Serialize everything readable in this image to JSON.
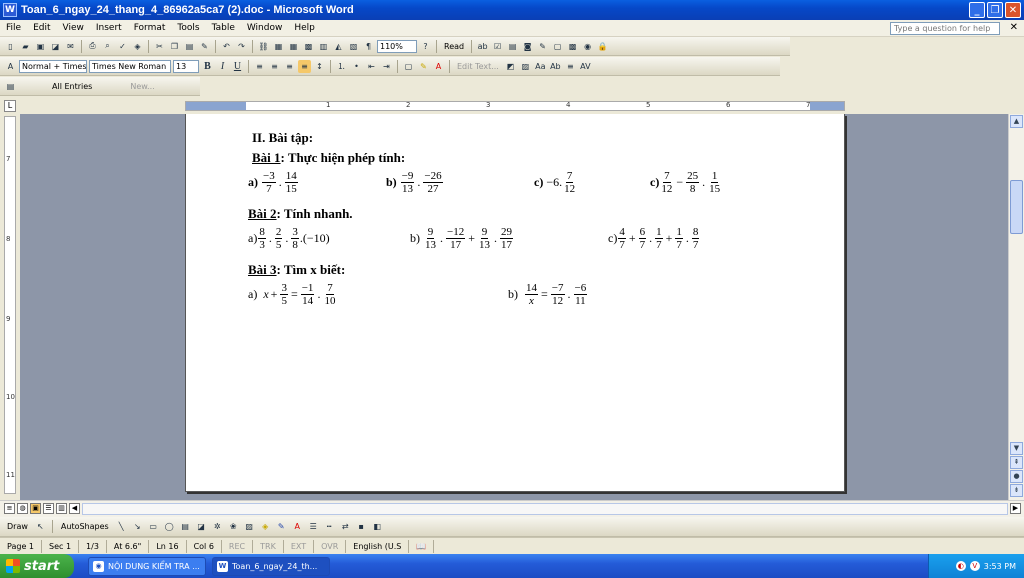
{
  "window": {
    "title": "Toan_6_ngay_24_thang_4_86962a5ca7 (2).doc - Microsoft Word",
    "app_icon": "W"
  },
  "menu": {
    "items": [
      "File",
      "Edit",
      "View",
      "Insert",
      "Format",
      "Tools",
      "Table",
      "Window",
      "Help"
    ],
    "help_placeholder": "Type a question for help"
  },
  "toolbar_standard": {
    "zoom": "110%",
    "read_label": "Read"
  },
  "toolbar_formatting": {
    "style": "Normal + Times",
    "font": "Times New Roman",
    "size": "13",
    "bold": "B",
    "italic": "I",
    "underline": "U",
    "edit_text_label": "Edit Text..."
  },
  "autotext": {
    "entries_label": "All Entries",
    "new_label": "New..."
  },
  "ruler": {
    "numbers": [
      "1",
      "2",
      "3",
      "4",
      "5",
      "6",
      "7"
    ],
    "vertical_numbers": [
      "7",
      "8",
      "9",
      "10",
      "11"
    ]
  },
  "document": {
    "section_heading": "II. Bài tập:",
    "bai1": {
      "title": "Bài 1",
      "text": ": Thực hiện phép tính:"
    },
    "bai2": {
      "title": "Bài 2",
      "text": ": Tính nhanh."
    },
    "bai3": {
      "title": "Bài 3",
      "text": ": Tìm x biết:"
    },
    "b1": {
      "a": {
        "label": "a)",
        "f1n": "−3",
        "f1d": "7",
        "f2n": "14",
        "f2d": "15"
      },
      "b": {
        "label": "b)",
        "f1n": "−9",
        "f1d": "13",
        "f2n": "−26",
        "f2d": "27"
      },
      "c": {
        "label": "c)",
        "pre": "−6.",
        "f1n": "7",
        "f1d": "12"
      },
      "d": {
        "label": "c)",
        "f1n": "7",
        "f1d": "12",
        "f2n": "25",
        "f2d": "8",
        "f3n": "1",
        "f3d": "15"
      }
    },
    "b2": {
      "a": {
        "label": "a)",
        "f1n": "8",
        "f1d": "3",
        "f2n": "2",
        "f2d": "5",
        "f3n": "3",
        "f3d": "8",
        "tail": ".(−10)"
      },
      "b": {
        "label": "b)",
        "f1n": "9",
        "f1d": "13",
        "f2n": "−12",
        "f2d": "17",
        "f3n": "9",
        "f3d": "13",
        "f4n": "29",
        "f4d": "17"
      },
      "c": {
        "label": "c)",
        "f1n": "4",
        "f1d": "7",
        "f2n": "6",
        "f2d": "7",
        "f3n": "1",
        "f3d": "7",
        "f4n": "1",
        "f4d": "7",
        "f5n": "8",
        "f5d": "7"
      }
    },
    "b3": {
      "a": {
        "label": "a)",
        "var": "x",
        "f1n": "3",
        "f1d": "5",
        "f2n": "−1",
        "f2d": "14",
        "f3n": "7",
        "f3d": "10"
      },
      "b": {
        "label": "b)",
        "f1n": "14",
        "f1d": "x",
        "f2n": "−7",
        "f2d": "12",
        "f3n": "−6",
        "f3d": "11"
      }
    }
  },
  "drawing": {
    "draw_label": "Draw",
    "autoshapes_label": "AutoShapes"
  },
  "status": {
    "page": "Page 1",
    "sec": "Sec 1",
    "pages": "1/3",
    "at": "At 6.6\"",
    "ln": "Ln 16",
    "col": "Col 6",
    "rec": "REC",
    "trk": "TRK",
    "ext": "EXT",
    "ovr": "OVR",
    "lang": "English (U.S"
  },
  "taskbar": {
    "start": "start",
    "task1": "NỘI DUNG KIỂM TRA ...",
    "task2": "Toan_6_ngay_24_th...",
    "clock": "3:53 PM"
  }
}
